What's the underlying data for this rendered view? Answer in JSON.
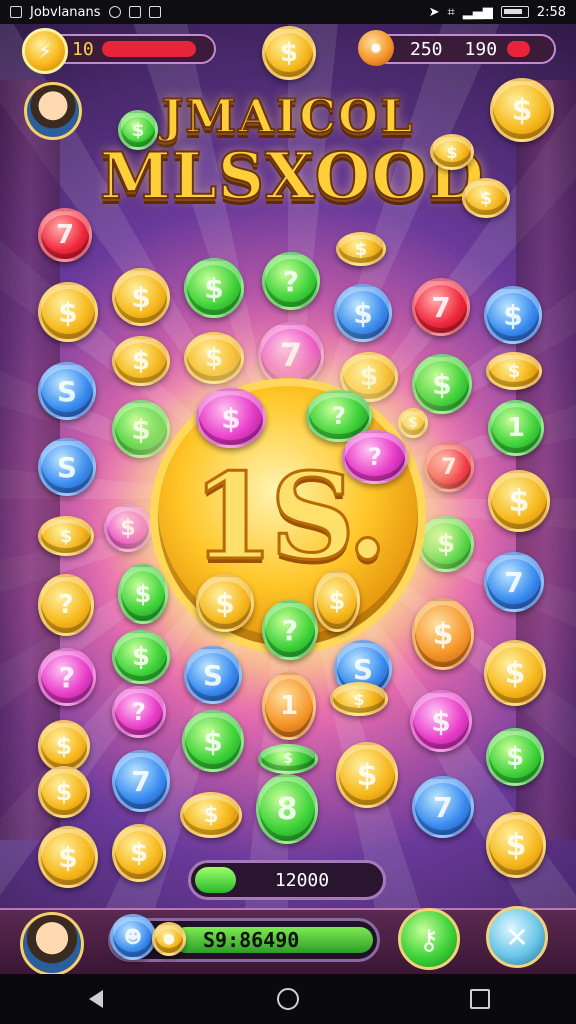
{
  "status_bar": {
    "app_name": "Jobvlanans",
    "time": "2:58"
  },
  "hud": {
    "left_value": "10",
    "right_value_1": "250",
    "right_value_2": "190",
    "health_fill_fraction": 0.85,
    "right_fill_fraction": 0.15
  },
  "title": {
    "line1": "JMAICOL",
    "line2": "MLSXOOD"
  },
  "center_coin": {
    "text": "1S."
  },
  "progress": {
    "value_text": "12000",
    "fill_fraction": 0.22
  },
  "bottom": {
    "balance_text": "S9:86490"
  },
  "colors": {
    "hud_red": "#e8243a",
    "hud_green": "#2fb82c",
    "gold": "#ffc628",
    "accent_purple": "#c58bd0"
  },
  "icons": {
    "top_left": "lightning-coin-icon",
    "top_center": "dollar-coin-icon",
    "top_right": "burst-icon",
    "bottom_right_1": "key-icon",
    "bottom_right_2": "crossed-tools-icon"
  }
}
